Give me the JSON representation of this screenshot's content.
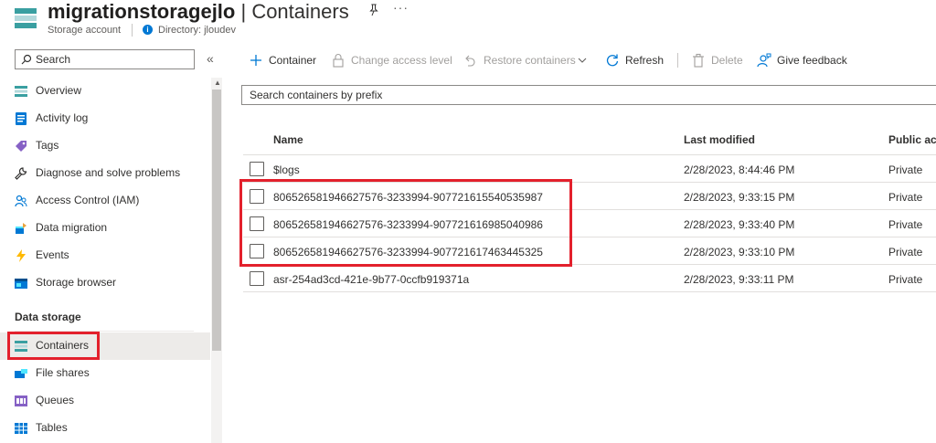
{
  "header": {
    "resource_name": "migrationstoragejlo",
    "separator": " | ",
    "page_name": "Containers",
    "resource_type": "Storage account",
    "directory": "Directory: jloudev",
    "more": "···"
  },
  "sidebar": {
    "search_placeholder": "Search",
    "collapse": "«",
    "items": [
      {
        "label": "Overview",
        "icon": "overview-icon"
      },
      {
        "label": "Activity log",
        "icon": "activity-log-icon"
      },
      {
        "label": "Tags",
        "icon": "tag-icon"
      },
      {
        "label": "Diagnose and solve problems",
        "icon": "wrench-icon"
      },
      {
        "label": "Access Control (IAM)",
        "icon": "people-icon"
      },
      {
        "label": "Data migration",
        "icon": "data-migration-icon"
      },
      {
        "label": "Events",
        "icon": "lightning-icon"
      },
      {
        "label": "Storage browser",
        "icon": "storage-browser-icon"
      }
    ],
    "section_data_storage": "Data storage",
    "data_storage_items": [
      {
        "label": "Containers",
        "icon": "containers-icon",
        "selected": true
      },
      {
        "label": "File shares",
        "icon": "file-shares-icon"
      },
      {
        "label": "Queues",
        "icon": "queues-icon"
      },
      {
        "label": "Tables",
        "icon": "tables-icon"
      }
    ]
  },
  "toolbar": {
    "container": "Container",
    "change_access_level": "Change access level",
    "restore_containers": "Restore containers",
    "refresh": "Refresh",
    "delete": "Delete",
    "give_feedback": "Give feedback"
  },
  "filter": {
    "placeholder": "Search containers by prefix"
  },
  "table": {
    "headers": {
      "name": "Name",
      "last_modified": "Last modified",
      "public_access": "Public acc"
    },
    "rows": [
      {
        "name": "$logs",
        "last_modified": "2/28/2023, 8:44:46 PM",
        "access": "Private"
      },
      {
        "name": "806526581946627576-3233994-907721615540535987",
        "last_modified": "2/28/2023, 9:33:15 PM",
        "access": "Private"
      },
      {
        "name": "806526581946627576-3233994-907721616985040986",
        "last_modified": "2/28/2023, 9:33:40 PM",
        "access": "Private"
      },
      {
        "name": "806526581946627576-3233994-907721617463445325",
        "last_modified": "2/28/2023, 9:33:10 PM",
        "access": "Private"
      },
      {
        "name": "asr-254ad3cd-421e-9b77-0ccfb919371a",
        "last_modified": "2/28/2023, 9:33:11 PM",
        "access": "Private"
      }
    ]
  },
  "colors": {
    "accent": "#0078d4",
    "highlight": "#e3202c",
    "selected_bg": "#edebe9"
  }
}
